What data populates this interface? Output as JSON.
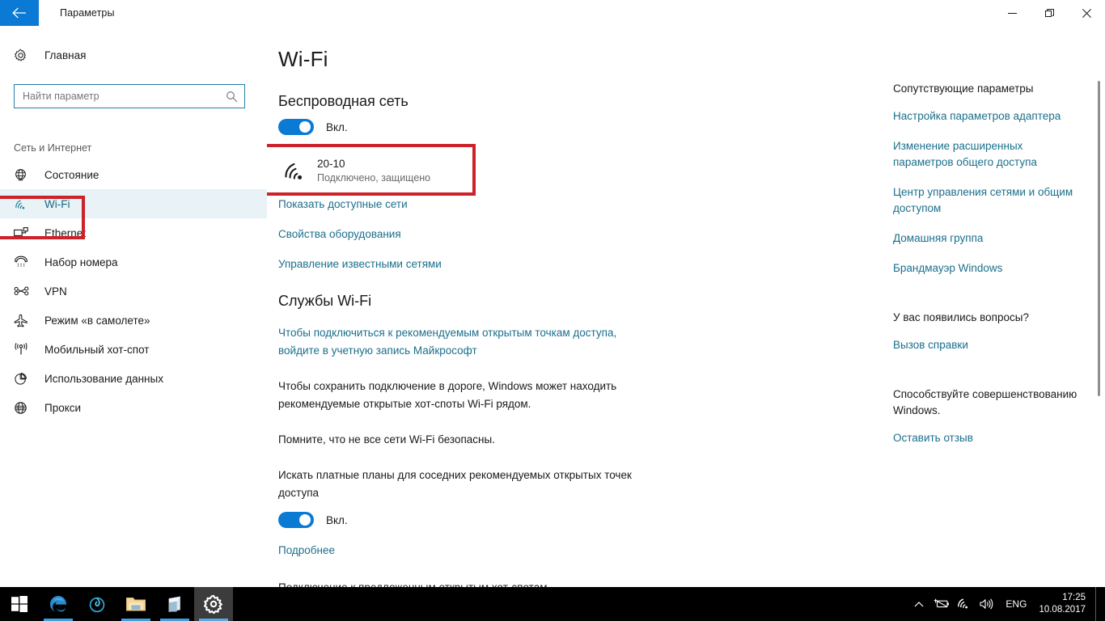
{
  "window": {
    "title": "Параметры",
    "back_icon": "back-arrow-icon",
    "minimize_icon": "minimize-icon",
    "maximize_icon": "maximize-icon",
    "close_icon": "close-icon"
  },
  "sidebar": {
    "home": {
      "label": "Главная",
      "icon": "gear-icon"
    },
    "search": {
      "value": "",
      "placeholder": "Найти параметр",
      "icon": "search-icon"
    },
    "section_label": "Сеть и Интернет",
    "items": [
      {
        "label": "Состояние",
        "icon": "globe-status-icon",
        "active": false
      },
      {
        "label": "Wi-Fi",
        "icon": "wifi-icon",
        "active": true
      },
      {
        "label": "Ethernet",
        "icon": "ethernet-icon",
        "active": false
      },
      {
        "label": "Набор номера",
        "icon": "dialup-phone-icon",
        "active": false
      },
      {
        "label": "VPN",
        "icon": "vpn-icon",
        "active": false
      },
      {
        "label": "Режим «в самолете»",
        "icon": "airplane-icon",
        "active": false
      },
      {
        "label": "Мобильный хот-спот",
        "icon": "hotspot-icon",
        "active": false
      },
      {
        "label": "Использование данных",
        "icon": "pie-chart-icon",
        "active": false
      },
      {
        "label": "Прокси",
        "icon": "globe-icon",
        "active": false
      }
    ]
  },
  "main": {
    "page_title": "Wi-Fi",
    "wireless": {
      "heading": "Беспроводная сеть",
      "toggle_label": "Вкл.",
      "toggle_on": true
    },
    "network": {
      "name": "20-10",
      "status": "Подключено, защищено",
      "icon": "wifi-connected-icon"
    },
    "links": [
      "Показать доступные сети",
      "Свойства оборудования",
      "Управление известными сетями"
    ],
    "services": {
      "heading": "Службы Wi-Fi",
      "link_paragraph": "Чтобы подключиться к рекомендуемым открытым точкам доступа, войдите в учетную запись Майкрософт",
      "paragraph1": "Чтобы сохранить подключение в дороге, Windows может находить рекомендуемые открытые хот-споты Wi-Fi рядом.",
      "paragraph2": "Помните, что не все сети Wi-Fi безопасны.",
      "paid_plans_label": "Искать платные планы для соседних рекомендуемых открытых точек доступа",
      "paid_plans_toggle_label": "Вкл.",
      "paid_plans_toggle_on": true,
      "more_link": "Подробнее",
      "next_heading": "Подключение к предложенным открытым хот-спотам"
    }
  },
  "rail": {
    "related_heading": "Сопутствующие параметры",
    "related_links": [
      "Настройка параметров адаптера",
      "Изменение расширенных параметров общего доступа",
      "Центр управления сетями и общим доступом",
      "Домашняя группа",
      "Брандмауэр Windows"
    ],
    "help_heading": "У вас появились вопросы?",
    "help_link": "Вызов справки",
    "feedback_heading": "Способствуйте совершенствованию Windows.",
    "feedback_link": "Оставить отзыв"
  },
  "taskbar": {
    "start_icon": "windows-start-icon",
    "apps": [
      {
        "name": "edge-icon",
        "running": true,
        "active": false
      },
      {
        "name": "browser-icon",
        "running": false,
        "active": false
      },
      {
        "name": "file-explorer-icon",
        "running": true,
        "active": false
      },
      {
        "name": "store-icon",
        "running": true,
        "active": false
      },
      {
        "name": "settings-icon",
        "running": true,
        "active": true
      }
    ],
    "tray": {
      "chevron_icon": "show-hidden-icons-icon",
      "battery_icon": "battery-icon",
      "network_icon": "wifi-tray-icon",
      "volume_icon": "volume-icon",
      "language": "ENG",
      "time": "17:25",
      "date": "10.08.2017"
    }
  },
  "colors": {
    "accent": "#0a7ad4",
    "link": "#1a6f8c",
    "highlight_box": "#cc2229",
    "active_nav_bg": "#e9f2f7"
  }
}
